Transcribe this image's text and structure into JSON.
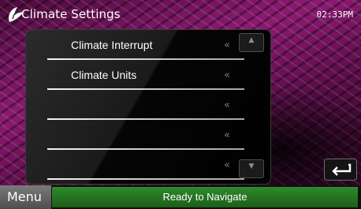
{
  "header": {
    "title": "Climate Settings",
    "clock": "02:33PM",
    "logo_icon": "climate-fan-icon"
  },
  "list": {
    "items": [
      {
        "label": "Climate Interrupt",
        "arrow": "«"
      },
      {
        "label": "Climate Units",
        "arrow": "«"
      },
      {
        "label": "",
        "arrow": "«"
      },
      {
        "label": "",
        "arrow": "«"
      },
      {
        "label": "",
        "arrow": "«"
      }
    ],
    "scroll_up_icon": "triangle-up-icon",
    "scroll_down_icon": "triangle-down-icon"
  },
  "footer": {
    "menu_label": "Menu",
    "status_text": "Ready to Navigate"
  },
  "colors": {
    "accent_green": "#2e8a2c",
    "background_magenta": "#8c1a72"
  }
}
